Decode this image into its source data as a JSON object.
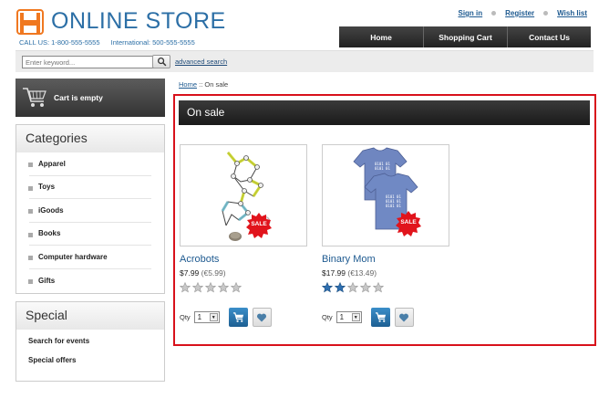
{
  "header": {
    "brand": "ONLINE STORE",
    "phone_local": "CALL US: 1-800-555-5555",
    "phone_intl": "International: 500-555-5555",
    "links": [
      "Sign in",
      "Register",
      "Wish list"
    ],
    "nav": [
      "Home",
      "Shopping Cart",
      "Contact Us"
    ]
  },
  "search": {
    "placeholder": "Enter keyword...",
    "advanced_label": "advanced search"
  },
  "cart": {
    "label": "Cart is empty"
  },
  "categories": {
    "title": "Categories",
    "items": [
      "Apparel",
      "Toys",
      "iGoods",
      "Books",
      "Computer hardware",
      "Gifts"
    ]
  },
  "special": {
    "title": "Special",
    "items": [
      "Search for events",
      "Special offers"
    ]
  },
  "breadcrumb": {
    "home": "Home",
    "separator": "::",
    "current": "On sale"
  },
  "section": {
    "title": "On sale"
  },
  "products": [
    {
      "name": "Acrobots",
      "price": "$7.99",
      "price_alt": "(€5.99)",
      "rating": 0,
      "badge": "SALE",
      "qty_label": "Qty",
      "qty": "1"
    },
    {
      "name": "Binary Mom",
      "price": "$17.99",
      "price_alt": "(€13.49)",
      "rating": 2,
      "badge": "SALE",
      "qty_label": "Qty",
      "qty": "1"
    }
  ],
  "colors": {
    "accent": "#2c6fa6",
    "highlight": "#d8111b",
    "sale": "#e1141c",
    "star_on": "#2f6fb0",
    "star_off": "#c8c8c8"
  }
}
